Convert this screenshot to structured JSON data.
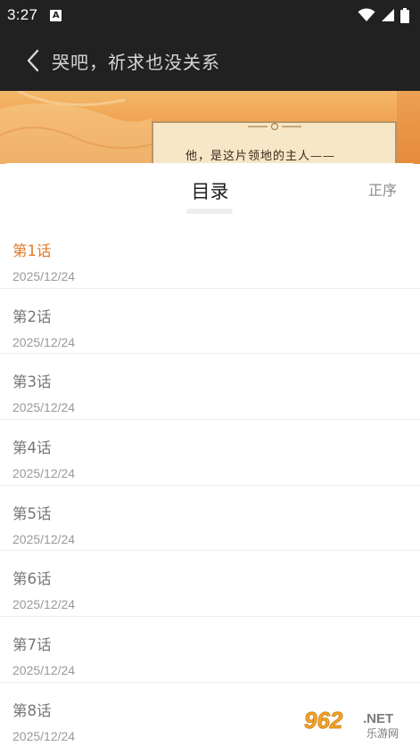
{
  "status_bar": {
    "time": "3:27",
    "notification_icon": "A",
    "icons": [
      "wifi-icon",
      "signal-icon",
      "battery-icon"
    ]
  },
  "app_bar": {
    "title": "哭吧，祈求也没关系",
    "back_icon": "chevron-left-icon"
  },
  "banner": {
    "caption": "他，是这片领地的主人——"
  },
  "catalog": {
    "title": "目录",
    "sort_label": "正序",
    "active_color": "#e07a2a",
    "chapters": [
      {
        "title": "第1话",
        "date": "2025/12/24"
      },
      {
        "title": "第2话",
        "date": "2025/12/24"
      },
      {
        "title": "第3话",
        "date": "2025/12/24"
      },
      {
        "title": "第4话",
        "date": "2025/12/24"
      },
      {
        "title": "第5话",
        "date": "2025/12/24"
      },
      {
        "title": "第6话",
        "date": "2025/12/24"
      },
      {
        "title": "第7话",
        "date": "2025/12/24"
      },
      {
        "title": "第8话",
        "date": "2025/12/24"
      }
    ]
  },
  "watermark": {
    "number": "962",
    "suffix": ".NET",
    "caption": "乐游网"
  }
}
